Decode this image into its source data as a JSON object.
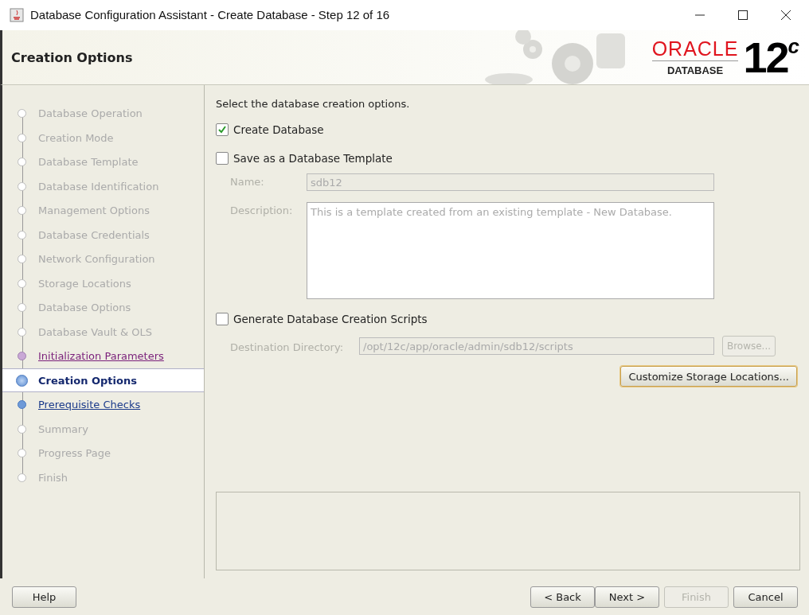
{
  "window": {
    "title": "Database Configuration Assistant - Create Database - Step 12 of 16"
  },
  "header": {
    "title": "Creation Options",
    "logo": {
      "brand": "ORACLE",
      "product": "DATABASE",
      "version": "12",
      "version_suffix": "c"
    }
  },
  "steps": [
    {
      "label": "Database Operation",
      "kind": "done",
      "selected": false
    },
    {
      "label": "Creation Mode",
      "kind": "done",
      "selected": false
    },
    {
      "label": "Database Template",
      "kind": "done",
      "selected": false
    },
    {
      "label": "Database Identification",
      "kind": "done",
      "selected": false
    },
    {
      "label": "Management Options",
      "kind": "done",
      "selected": false
    },
    {
      "label": "Database Credentials",
      "kind": "done",
      "selected": false
    },
    {
      "label": "Network Configuration",
      "kind": "done",
      "selected": false
    },
    {
      "label": "Storage Locations",
      "kind": "done",
      "selected": false
    },
    {
      "label": "Database Options",
      "kind": "done",
      "selected": false
    },
    {
      "label": "Database Vault & OLS",
      "kind": "done",
      "selected": false
    },
    {
      "label": "Initialization Parameters",
      "kind": "visited",
      "selected": false
    },
    {
      "label": "Creation Options",
      "kind": "current",
      "selected": true
    },
    {
      "label": "Prerequisite Checks",
      "kind": "link",
      "selected": false
    },
    {
      "label": "Summary",
      "kind": "pending",
      "selected": false
    },
    {
      "label": "Progress Page",
      "kind": "pending",
      "selected": false
    },
    {
      "label": "Finish",
      "kind": "pending",
      "selected": false
    }
  ],
  "content": {
    "instruction": "Select the database creation options.",
    "create_database": {
      "label": "Create Database",
      "checked": true
    },
    "save_template": {
      "label": "Save as a Database Template",
      "checked": false,
      "name": {
        "label": "Name:",
        "value": "sdb12",
        "disabled": true
      },
      "description": {
        "label": "Description:",
        "value": "This is a template created from an existing template - New Database.",
        "disabled": true
      }
    },
    "generate_scripts": {
      "label": "Generate Database Creation Scripts",
      "checked": false,
      "destination": {
        "label": "Destination Directory:",
        "value": "/opt/12c/app/oracle/admin/sdb12/scripts",
        "disabled": true
      },
      "browse_button": {
        "label": "Browse...",
        "disabled": true
      }
    },
    "customize_button": {
      "label": "Customize Storage Locations...",
      "disabled": false
    }
  },
  "help_button": {
    "label": "Help",
    "disabled": false
  },
  "nav_buttons": [
    {
      "label": "< Back",
      "disabled": false
    },
    {
      "label": "Next >",
      "disabled": false
    },
    {
      "label": "Finish",
      "disabled": true
    },
    {
      "label": "Cancel",
      "disabled": false
    }
  ]
}
